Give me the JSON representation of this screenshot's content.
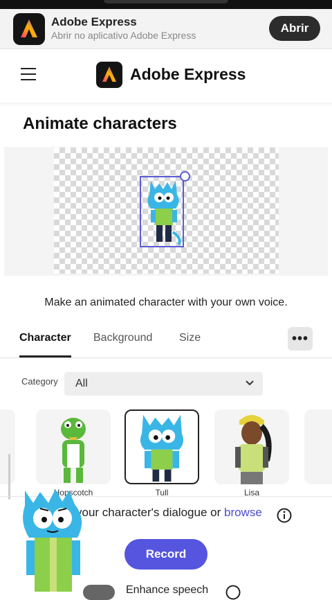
{
  "banner": {
    "app_name": "Adobe Express",
    "subtitle": "Abrir no aplicativo Adobe Express",
    "open_label": "Abrir"
  },
  "header": {
    "brand": "Adobe Express"
  },
  "page": {
    "title": "Animate characters",
    "tagline": "Make an animated character with your own voice."
  },
  "tabs": [
    {
      "label": "Character",
      "active": true
    },
    {
      "label": "Background",
      "active": false
    },
    {
      "label": "Size",
      "active": false
    }
  ],
  "more_label": "•••",
  "category": {
    "label": "Category",
    "value": "All"
  },
  "characters": [
    {
      "label": "Hopscotch",
      "selected": false
    },
    {
      "label": "Tull",
      "selected": true
    },
    {
      "label": "Lisa",
      "selected": false
    }
  ],
  "dialogue": {
    "text": "your character's dialogue or",
    "link": "browse"
  },
  "record_label": "Record",
  "toggle_label": "Enhance speech",
  "colors": {
    "accent": "#5555e0",
    "character_blue": "#39b6e6",
    "selection": "#5b5bd6"
  }
}
